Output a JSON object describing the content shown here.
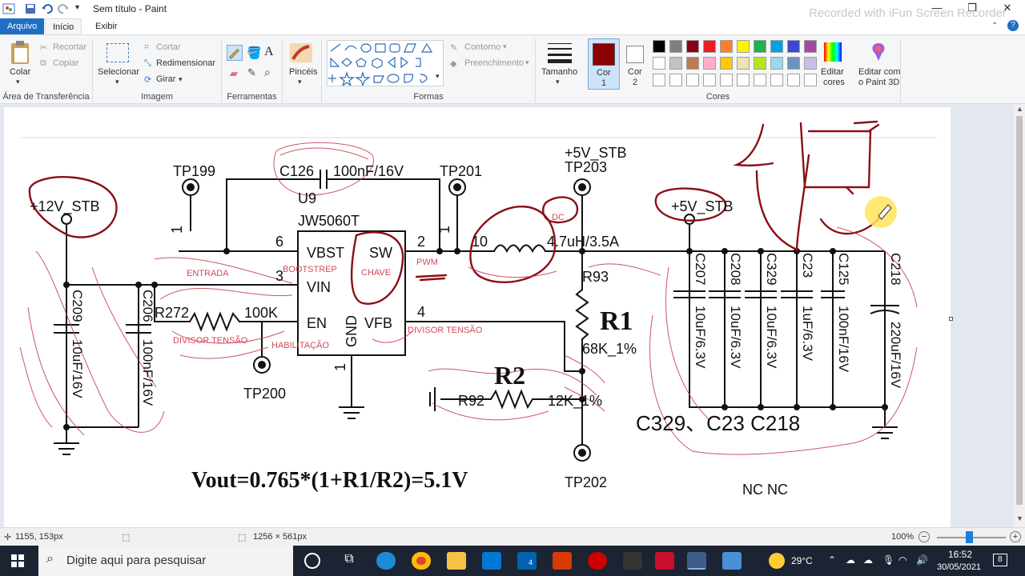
{
  "window": {
    "title": "Sem título - Paint",
    "watermark": "Recorded with iFun Screen Recorder"
  },
  "tabs": {
    "file": "Arquivo",
    "home": "Início",
    "view": "Exibir"
  },
  "ribbon": {
    "clipboard": {
      "paste": "Colar",
      "cut": "Recortar",
      "copy": "Copiar",
      "group": "Área de Transferência"
    },
    "image": {
      "select": "Selecionar",
      "crop": "Cortar",
      "resize": "Redimensionar",
      "rotate": "Girar",
      "group": "Imagem"
    },
    "tools": {
      "group": "Ferramentas"
    },
    "brushes": {
      "label": "Pincéis"
    },
    "shapes": {
      "outline": "Contorno",
      "fill": "Preenchimento",
      "group": "Formas"
    },
    "size": {
      "label": "Tamanho"
    },
    "colors": {
      "color1": "Cor",
      "color1_num": "1",
      "color2": "Cor",
      "color2_num": "2",
      "edit": "Editar",
      "edit2": "cores",
      "paint3d": "Editar com",
      "paint3d2": "o Paint 3D",
      "group": "Cores",
      "color1_value": "#8b0000",
      "palette_row1": [
        "#000000",
        "#7f7f7f",
        "#880015",
        "#ed1c24",
        "#ff7f27",
        "#fff200",
        "#22b14c",
        "#00a2e8",
        "#3f48cc",
        "#a349a4"
      ],
      "palette_row2": [
        "#ffffff",
        "#c3c3c3",
        "#b97a57",
        "#ffaec9",
        "#ffc90e",
        "#efe4b0",
        "#b5e61d",
        "#99d9ea",
        "#7092be",
        "#c8bfe7"
      ]
    }
  },
  "schematic": {
    "tp199": "TP199",
    "tp201": "TP201",
    "tp203": "TP203",
    "tp200": "TP200",
    "tp202": "TP202",
    "v5_top": "+5V_STB",
    "v5_right": "+5V_STB",
    "v12": "+12V_STB",
    "c126": "C126",
    "c126_val": "100nF/16V",
    "u9": "U9",
    "ic": "JW5060T",
    "pin_vbst": "VBST",
    "pin_sw": "SW",
    "pin_vin": "VIN",
    "pin_en": "EN",
    "pin_gnd": "GND",
    "pin_vfb": "VFB",
    "n6": "6",
    "n2": "2",
    "n3": "3",
    "n4": "4",
    "n1": "1",
    "n1b": "1",
    "n1c": "1",
    "n10": "10",
    "inductor": "4.7uH/3.5A",
    "r93": "R93",
    "r1": "R1",
    "r1_val": "68K_1%",
    "r2": "R2",
    "r92": "R92",
    "r92_val": "12K_1%",
    "r272": "R272",
    "r272_val": "100K",
    "c209": "C209",
    "c209_val": "10uF/16V",
    "c206": "C206",
    "c206_val": "100nF/16V",
    "c207": "C207",
    "c207_val": "10uF/6.3V",
    "c208": "C208",
    "c208_val": "10uF/6.3V",
    "c329": "C329",
    "c329_val": "10uF/6.3V",
    "c23": "C23",
    "c23_val": "1uF/6.3V",
    "c125": "C125",
    "c125_val": "100nF/16V",
    "c218": "C218",
    "c218_val": "220uF/16V",
    "bottom_caps": "C329、C23  C218",
    "nc": "NC   NC",
    "formula": "Vout=0.765*(1+R1/R2)=5.1V",
    "ann_bootstrap": "BOOTSTREP",
    "ann_chave": "CHAVE",
    "ann_pwm": "PWM",
    "ann_entrada": "ENTRADA",
    "ann_div1": "DIVISOR TENSÃO",
    "ann_div2": "DIVISOR TENSÃO",
    "ann_hab": "HABILITAÇÃO",
    "ann_dc": "DC"
  },
  "status": {
    "cursor": "1155, 153px",
    "size": "1256 × 561px",
    "zoom": "100%"
  },
  "taskbar": {
    "search": "Digite aqui para pesquisar",
    "temp": "29°C",
    "time": "16:52",
    "date": "30/05/2021",
    "notif": "8"
  }
}
